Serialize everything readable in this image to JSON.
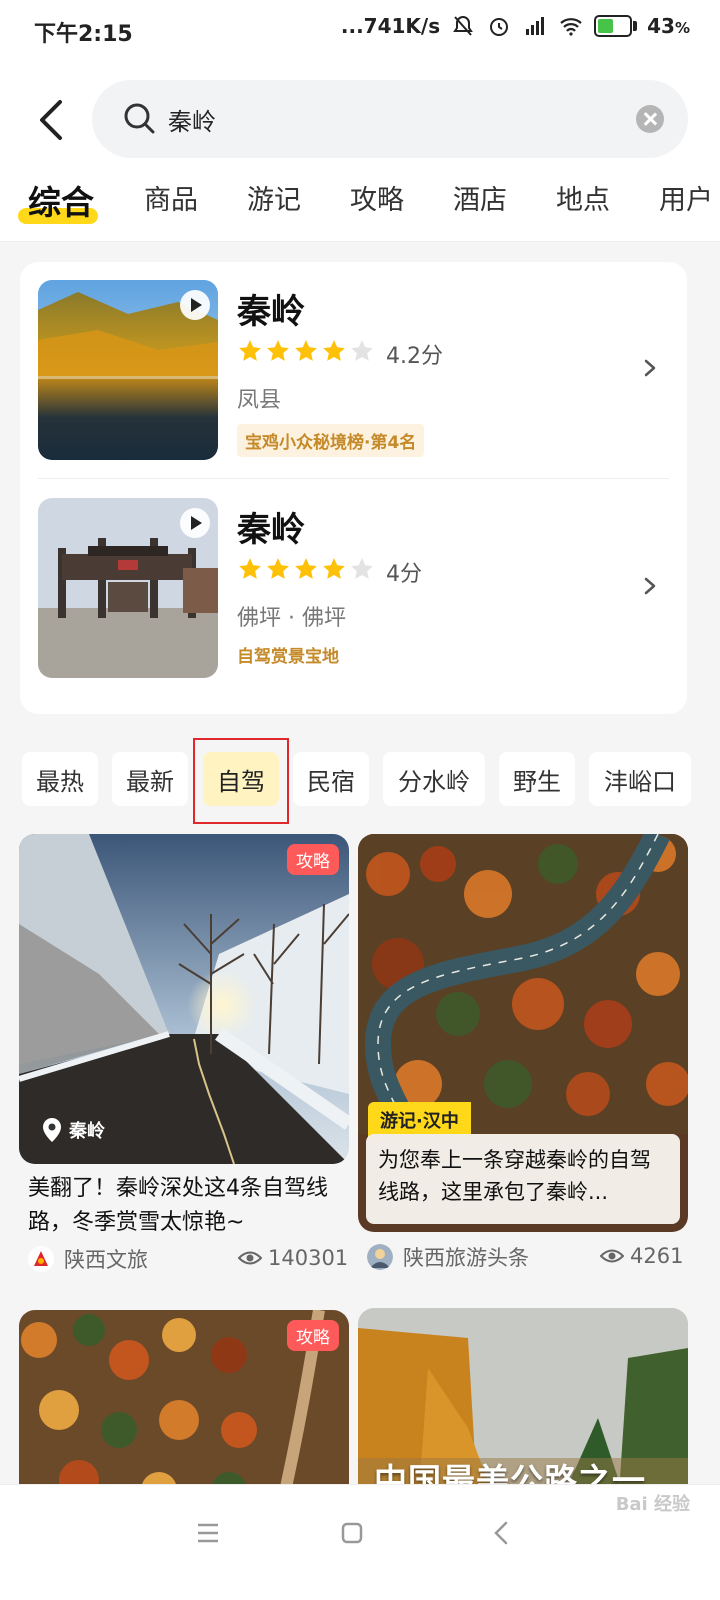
{
  "status_bar": {
    "time": "下午2:15",
    "net_speed": "...741K/s",
    "battery": "43",
    "battery_unit": "%"
  },
  "search": {
    "query": "秦岭"
  },
  "tabs": [
    {
      "label": "综合",
      "active": true
    },
    {
      "label": "商品"
    },
    {
      "label": "游记"
    },
    {
      "label": "攻略"
    },
    {
      "label": "酒店"
    },
    {
      "label": "地点"
    },
    {
      "label": "用户"
    }
  ],
  "poi_results": [
    {
      "name": "秦岭",
      "rating": 4.2,
      "score_text": "4.2分",
      "location": "凤县",
      "badge": "宝鸡小众秘境榜·第4名"
    },
    {
      "name": "秦岭",
      "rating": 4,
      "score_text": "4分",
      "location": "佛坪 · 佛坪",
      "badge": "自驾赏景宝地"
    }
  ],
  "filters": [
    {
      "label": "最热"
    },
    {
      "label": "最新"
    },
    {
      "label": "自驾",
      "active": true
    },
    {
      "label": "民宿"
    },
    {
      "label": "分水岭"
    },
    {
      "label": "野生"
    },
    {
      "label": "沣峪口"
    }
  ],
  "feed": [
    {
      "tag": "攻略",
      "location": "秦岭",
      "title": "美翻了！秦岭深处这4条自驾线路，冬季赏雪太惊艳~",
      "author": "陕西文旅",
      "views": "140301"
    },
    {
      "tag": "游记·汉中",
      "title": "为您奉上一条穿越秦岭的自驾线路，这里承包了秦岭...",
      "author": "陕西旅游头条",
      "views": "4261"
    },
    {
      "tag": "攻略"
    },
    {
      "overlay_text": "中国最美公路之一"
    }
  ],
  "watermark": "Bai 经验",
  "colors": {
    "accent_yellow": "#ffd919",
    "tag_red": "#ff5a5a",
    "badge_brown": "#c58a2a",
    "highlight_red": "#e0272b"
  }
}
